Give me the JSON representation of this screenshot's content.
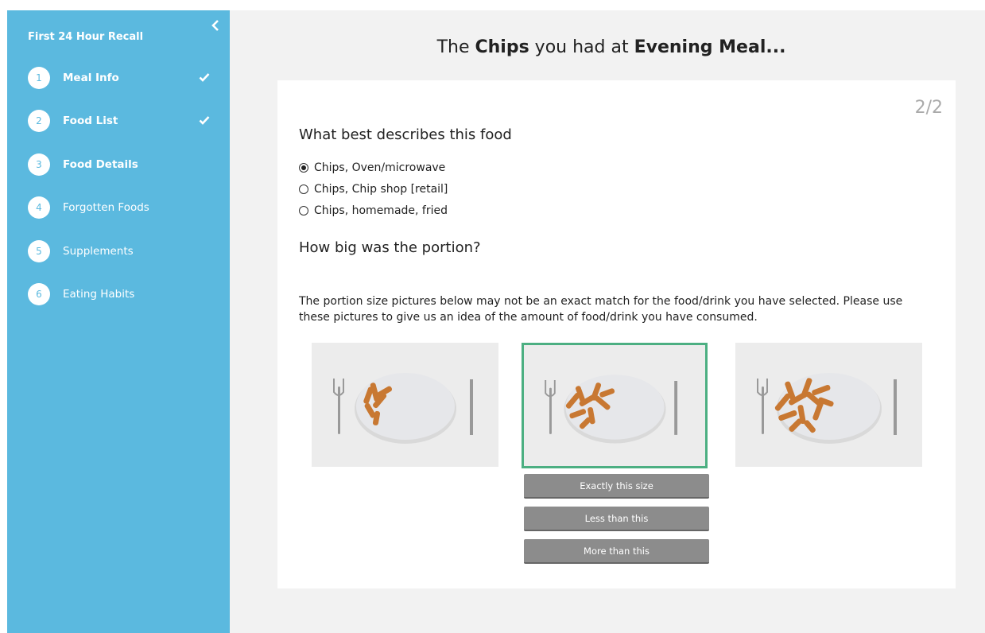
{
  "sidebar": {
    "title": "First 24 Hour Recall",
    "steps": [
      {
        "num": "1",
        "label": "Meal Info",
        "state": "done"
      },
      {
        "num": "2",
        "label": "Food List",
        "state": "done"
      },
      {
        "num": "3",
        "label": "Food Details",
        "state": "active"
      },
      {
        "num": "4",
        "label": "Forgotten Foods",
        "state": "pending"
      },
      {
        "num": "5",
        "label": "Supplements",
        "state": "pending"
      },
      {
        "num": "6",
        "label": "Eating Habits",
        "state": "pending"
      }
    ]
  },
  "header": {
    "prefix": "The ",
    "food": "Chips",
    "middle": " you had at ",
    "meal": "Evening Meal..."
  },
  "card": {
    "page": "2/2",
    "question1": "What best describes this food",
    "options": [
      {
        "label": "Chips, Oven/microwave",
        "checked": true
      },
      {
        "label": "Chips, Chip shop [retail]",
        "checked": false
      },
      {
        "label": "Chips, homemade, fried",
        "checked": false
      }
    ],
    "question2": "How big was the portion?",
    "notice": "The portion size pictures below may not be an exact match for the food/drink you have selected. Please use these pictures to give us an idea of the amount of food/drink you have consumed.",
    "buttons": {
      "exact": "Exactly this size",
      "less": "Less than this",
      "more": "More than this"
    }
  },
  "colors": {
    "sidebar": "#5bb9df",
    "selected_border": "#4caf82",
    "button": "#8c8c8c"
  }
}
